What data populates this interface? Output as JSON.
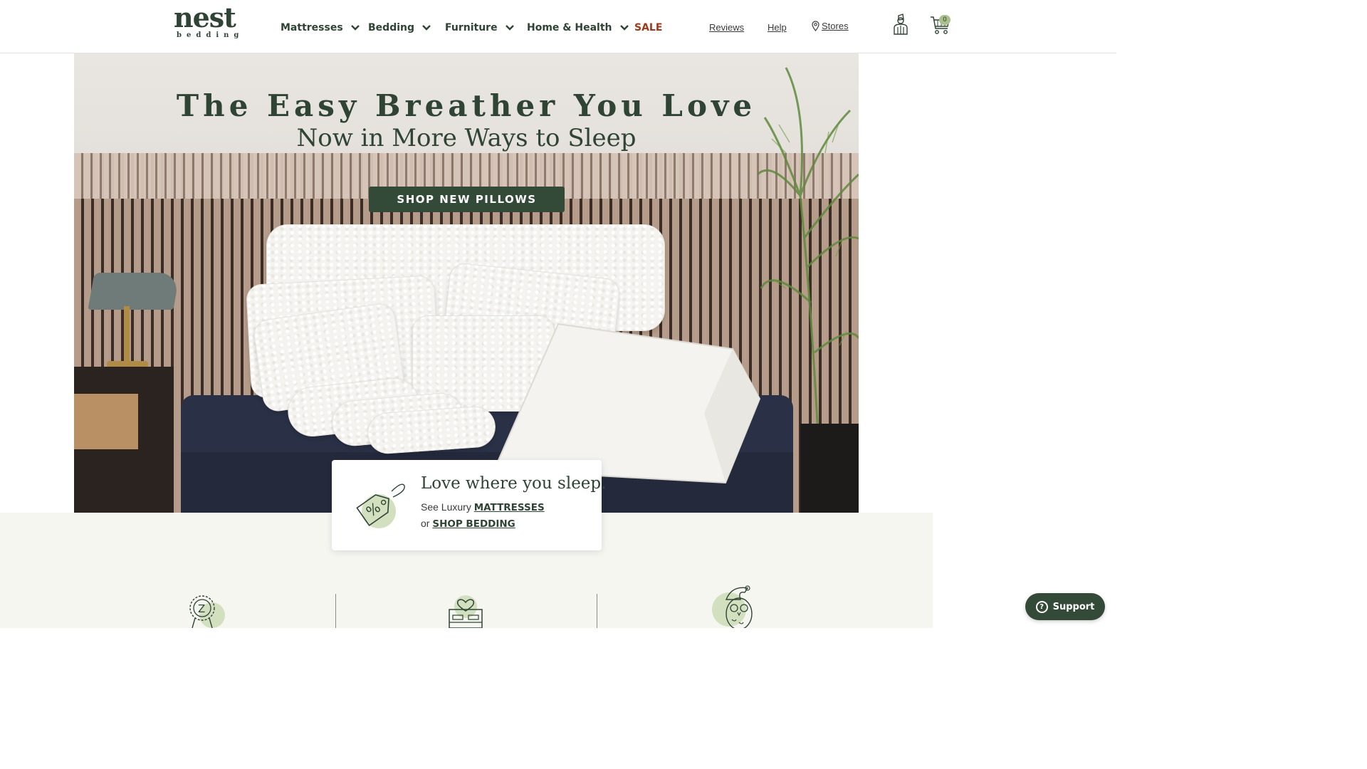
{
  "header": {
    "logo": {
      "word": "nest",
      "sub": "bedding"
    },
    "nav": [
      {
        "label": "Mattresses",
        "has_dropdown": true
      },
      {
        "label": "Bedding",
        "has_dropdown": true
      },
      {
        "label": "Furniture",
        "has_dropdown": true
      },
      {
        "label": "Home & Health",
        "has_dropdown": true
      },
      {
        "label": "SALE",
        "has_dropdown": false
      }
    ],
    "utility_links": {
      "reviews": "Reviews",
      "help": "Help",
      "stores": "Stores"
    },
    "account_icon": "account-icon",
    "cart": {
      "icon": "cart-icon",
      "count": "0"
    }
  },
  "hero": {
    "title": "The Easy Breather You Love",
    "subtitle": "Now in More Ways to Sleep",
    "cta": "SHOP NEW PILLOWS"
  },
  "promo_card": {
    "icon": "price-tag-percent-icon",
    "title": "Love where you sleep.",
    "line1_prefix": "See Luxury",
    "line1_link": "MATTRESSES",
    "line2_prefix": "or",
    "line2_link": "SHOP BEDDING"
  },
  "features": {
    "icons": [
      "award-ribbon-icon",
      "bed-heart-icon",
      "owl-sleep-icon"
    ]
  },
  "support": {
    "label": "Support",
    "icon": "help-circle-icon"
  },
  "colors": {
    "brand_green": "#344a39",
    "sale_red": "#a0391c",
    "accent_sage": "#a9c08d",
    "band_bg": "#f6f6f1"
  }
}
